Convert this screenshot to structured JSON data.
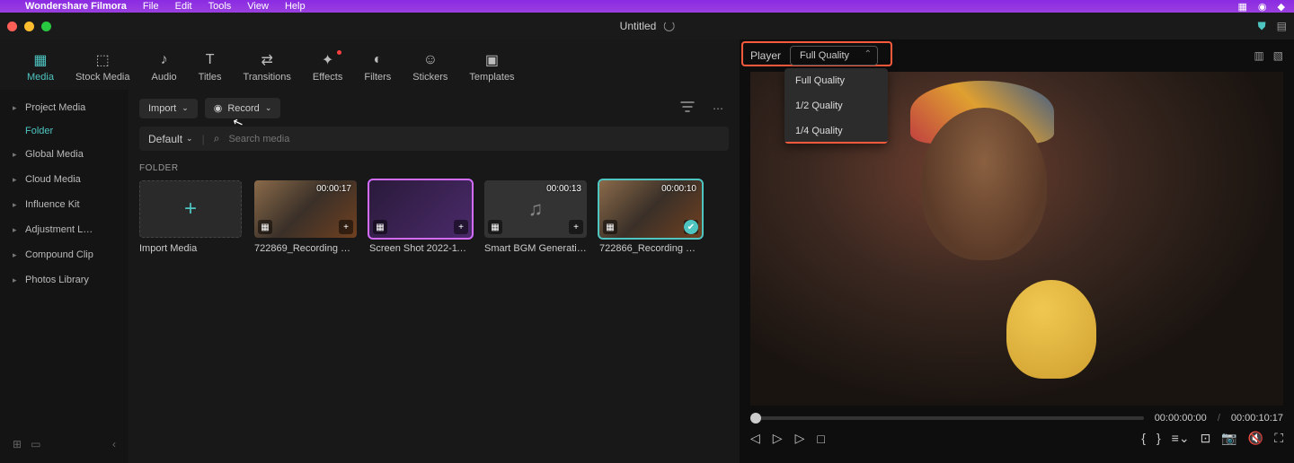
{
  "menubar": {
    "app": "Wondershare Filmora",
    "items": [
      "File",
      "Edit",
      "Tools",
      "View",
      "Help"
    ]
  },
  "project": {
    "title": "Untitled"
  },
  "tabs": [
    {
      "id": "media",
      "label": "Media",
      "icon": "▦"
    },
    {
      "id": "stock",
      "label": "Stock Media",
      "icon": "⬚"
    },
    {
      "id": "audio",
      "label": "Audio",
      "icon": "♪"
    },
    {
      "id": "titles",
      "label": "Titles",
      "icon": "T"
    },
    {
      "id": "transitions",
      "label": "Transitions",
      "icon": "⇄"
    },
    {
      "id": "effects",
      "label": "Effects",
      "icon": "✦"
    },
    {
      "id": "filters",
      "label": "Filters",
      "icon": "◐"
    },
    {
      "id": "stickers",
      "label": "Stickers",
      "icon": "☺"
    },
    {
      "id": "templates",
      "label": "Templates",
      "icon": "▣"
    }
  ],
  "active_tab": "media",
  "sidebar": {
    "items": [
      {
        "label": "Project Media",
        "expanded": true,
        "children": [
          {
            "label": "Folder"
          }
        ]
      },
      {
        "label": "Global Media"
      },
      {
        "label": "Cloud Media"
      },
      {
        "label": "Influence Kit"
      },
      {
        "label": "Adjustment L…"
      },
      {
        "label": "Compound Clip"
      },
      {
        "label": "Photos Library"
      }
    ],
    "active": "Folder"
  },
  "toolbar": {
    "import": "Import",
    "record": "Record",
    "sort": "Default"
  },
  "search": {
    "placeholder": "Search media"
  },
  "section": "FOLDER",
  "media": [
    {
      "kind": "import",
      "label": "Import Media"
    },
    {
      "kind": "video",
      "label": "722869_Recording P…",
      "dur": "00:00:17",
      "style": "person"
    },
    {
      "kind": "image",
      "label": "Screen Shot 2022-11…",
      "dur": "",
      "style": "screenshot",
      "purple": true
    },
    {
      "kind": "audio",
      "label": "Smart BGM Generati…",
      "dur": "00:00:13",
      "style": "audio"
    },
    {
      "kind": "video",
      "label": "722866_Recording P…",
      "dur": "00:00:10",
      "style": "person",
      "selected": true
    }
  ],
  "player": {
    "label": "Player",
    "quality_selected": "Full Quality",
    "quality_options": [
      "Full Quality",
      "1/2 Quality",
      "1/4 Quality"
    ],
    "time_current": "00:00:00:00",
    "time_total": "00:00:10:17"
  }
}
